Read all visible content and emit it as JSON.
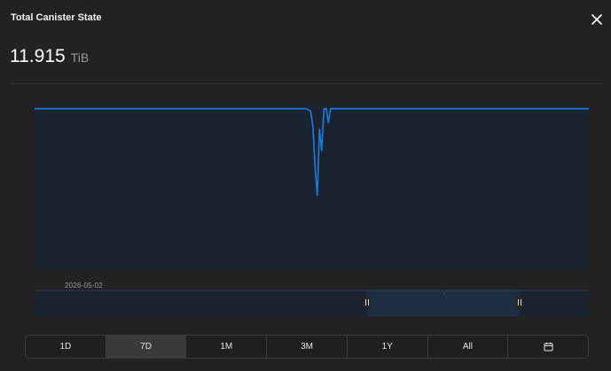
{
  "header": {
    "title": "Total Canister State"
  },
  "summary": {
    "value": "11.915",
    "unit": "TiB"
  },
  "icons": {
    "close": "close-icon",
    "calendar": "calendar-icon"
  },
  "colors": {
    "line": "#1f7ae0",
    "fill": "#1a2430",
    "navigator_selected": "#1d2d42"
  },
  "chart_data": {
    "type": "area",
    "title": "",
    "xlabel": "",
    "ylabel": "",
    "grid": false,
    "legend": "none",
    "ylim": [
      0,
      1
    ],
    "x": [
      0,
      0.2,
      0.4,
      0.49,
      0.498,
      0.502,
      0.506,
      0.51,
      0.514,
      0.518,
      0.522,
      0.526,
      0.53,
      0.534,
      0.538,
      0.6,
      0.8,
      1.0
    ],
    "values": [
      0.975,
      0.975,
      0.975,
      0.975,
      0.96,
      0.87,
      0.62,
      0.45,
      0.85,
      0.72,
      0.975,
      0.975,
      0.89,
      0.975,
      0.975,
      0.975,
      0.975,
      0.975
    ]
  },
  "navigator": {
    "start_label": "2026-05-02",
    "selection": [
      0.6,
      0.875
    ]
  },
  "range_buttons": {
    "items": [
      {
        "label": "1D",
        "active": false
      },
      {
        "label": "7D",
        "active": true
      },
      {
        "label": "1M",
        "active": false
      },
      {
        "label": "3M",
        "active": false
      },
      {
        "label": "1Y",
        "active": false
      },
      {
        "label": "All",
        "active": false
      }
    ]
  }
}
